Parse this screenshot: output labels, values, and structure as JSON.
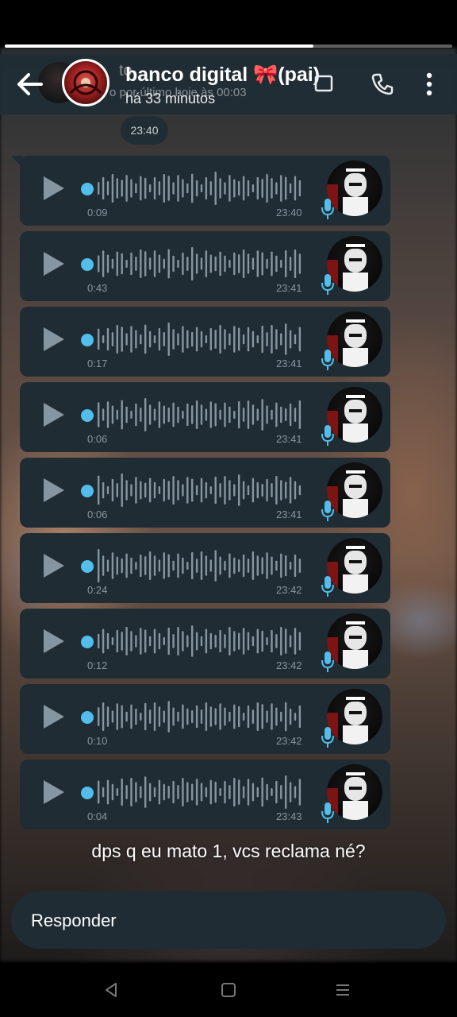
{
  "header": {
    "contact_name": "banco digital 🎀(pai)",
    "last_seen": "há 33 minutos",
    "ghost_name_fragment": "to",
    "ghost_status": "o por último hoje às 00:03"
  },
  "date_chip": "23:40",
  "voice_messages": [
    {
      "duration": "0:09",
      "time": "23:40"
    },
    {
      "duration": "0:43",
      "time": "23:41"
    },
    {
      "duration": "0:17",
      "time": "23:41"
    },
    {
      "duration": "0:06",
      "time": "23:41"
    },
    {
      "duration": "0:06",
      "time": "23:41"
    },
    {
      "duration": "0:24",
      "time": "23:42"
    },
    {
      "duration": "0:12",
      "time": "23:42"
    },
    {
      "duration": "0:10",
      "time": "23:42"
    },
    {
      "duration": "0:04",
      "time": "23:43"
    }
  ],
  "story_caption": "dps q eu mato 1, vcs reclama né?",
  "reply": {
    "placeholder": "Responder"
  },
  "story_progress": 0.69,
  "colors": {
    "bubble": "#1f2c34",
    "accent_blue": "#53bdeb",
    "muted": "#8696a0"
  },
  "icons": [
    "back-arrow-icon",
    "video-call-icon",
    "phone-icon",
    "more-vert-icon",
    "play-icon",
    "mic-icon",
    "nav-back-icon",
    "nav-home-icon",
    "nav-recents-icon"
  ]
}
